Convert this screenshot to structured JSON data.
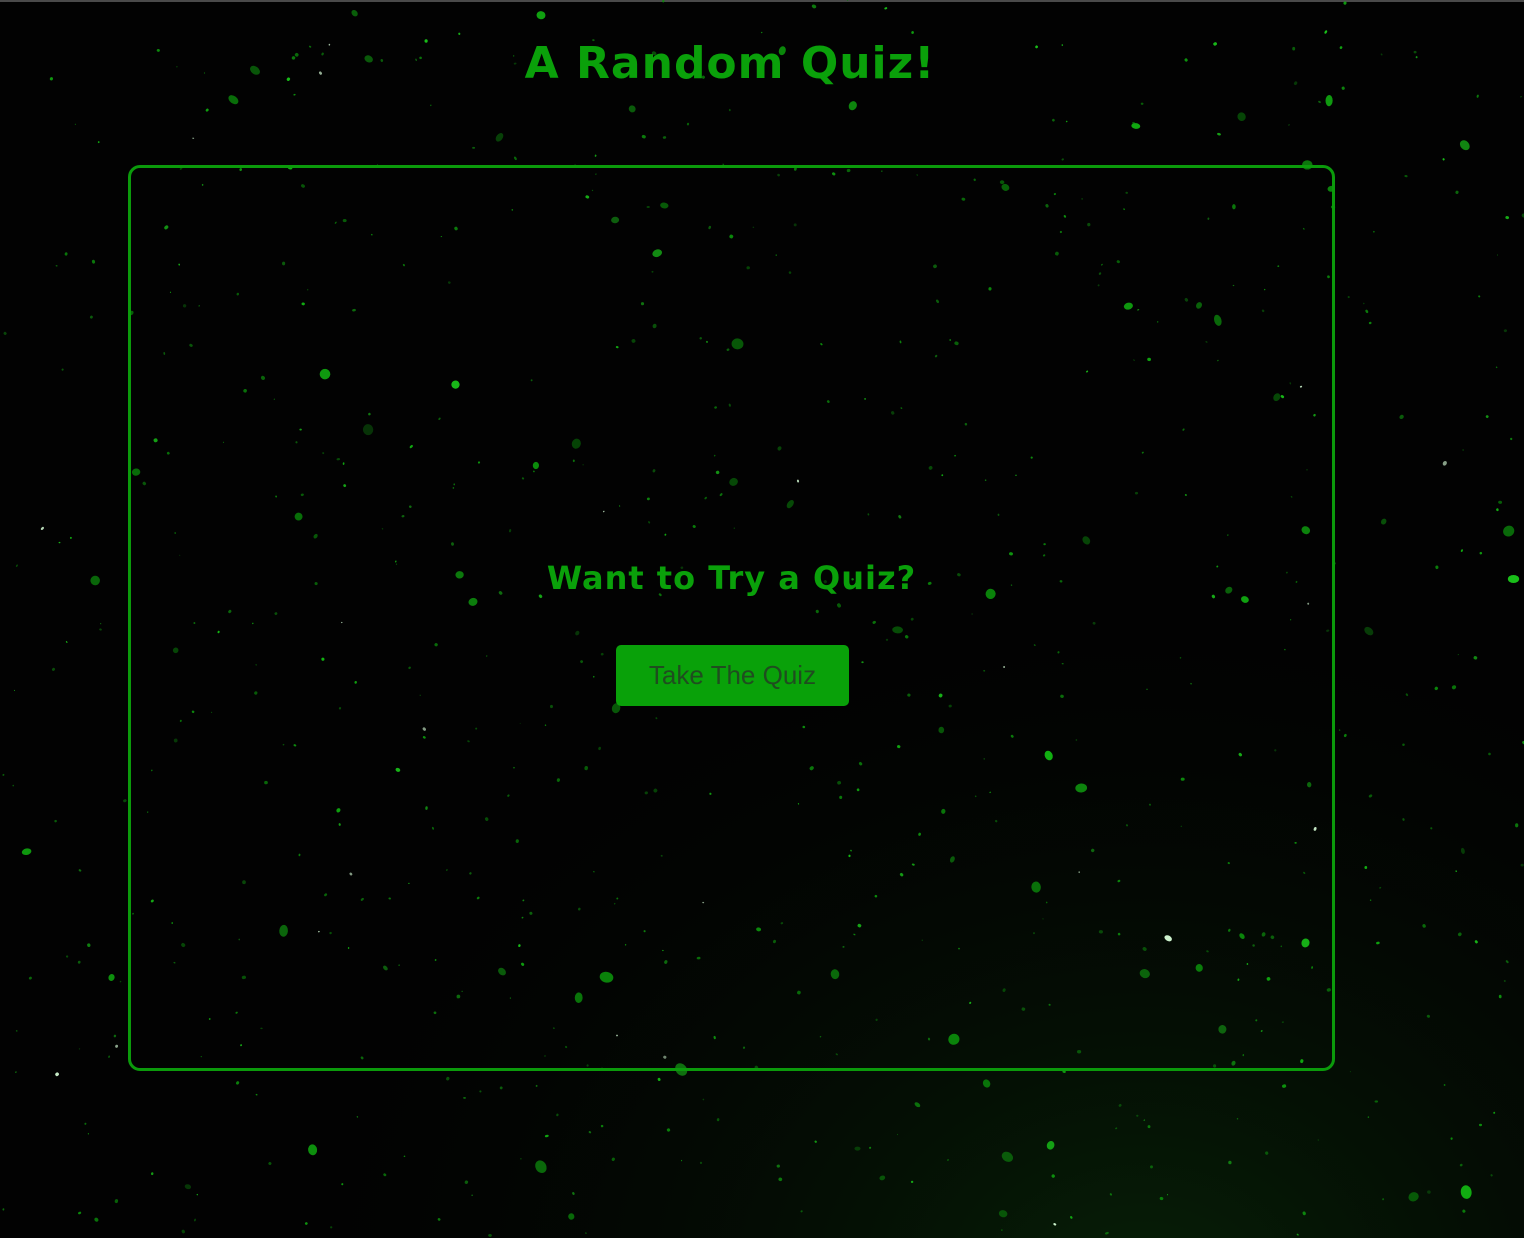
{
  "header": {
    "title": "A Random Quiz!"
  },
  "card": {
    "heading": "Want to Try a Quiz?",
    "button_label": "Take The Quiz"
  },
  "theme": {
    "accent": "#0aa00a",
    "background": "#020202",
    "button_bg": "#09a109",
    "button_text": "#1f4d1f"
  },
  "background_image": "green-starfield"
}
